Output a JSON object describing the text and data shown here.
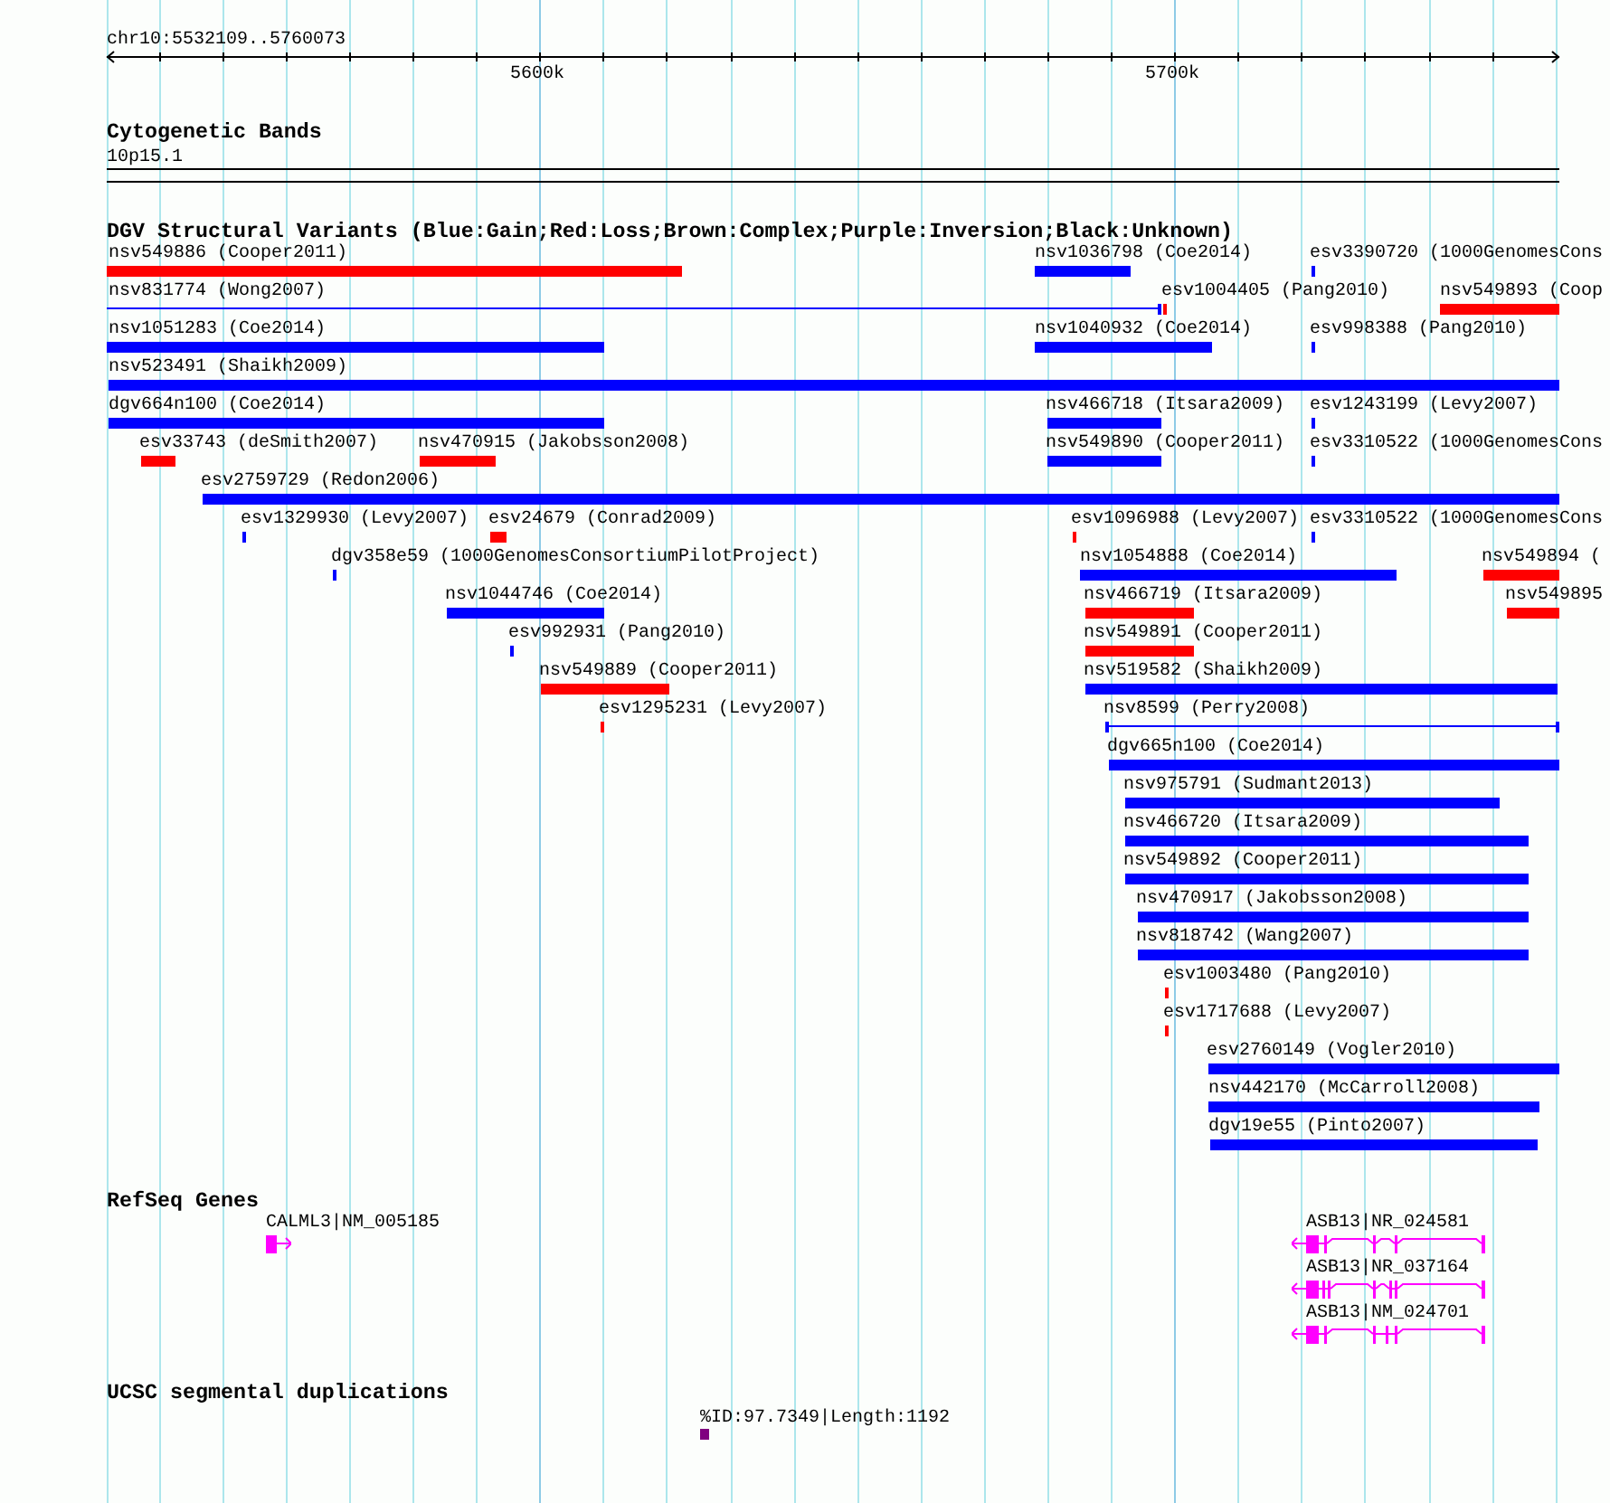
{
  "ruler": {
    "position": "chr10:5532109..5760073",
    "tick_labels": [
      "5600k",
      "5700k"
    ]
  },
  "cytoband_track": {
    "title": "Cytogenetic Bands",
    "band": "10p15.1"
  },
  "dgv_track": {
    "title": "DGV Structural Variants (Blue:Gain;Red:Loss;Brown:Complex;Purple:Inversion;Black:Unknown)",
    "rows": [
      {
        "variants": [
          {
            "label": "nsv549886 (Cooper2011)",
            "kind": "bar",
            "color": "#ff0000"
          },
          {
            "label": "nsv1036798 (Coe2014)",
            "kind": "bar",
            "color": "#0000ff"
          },
          {
            "label": "esv3390720 (1000GenomesCons",
            "kind": "bar",
            "color": "#0000ff"
          }
        ]
      },
      {
        "variants": [
          {
            "label": "nsv831774 (Wong2007)",
            "kind": "line",
            "color": "#0000ff"
          },
          {
            "label": "esv1004405 (Pang2010)",
            "kind": "bar",
            "color": "#ff0000"
          },
          {
            "label": "nsv549893 (Coop",
            "kind": "bar",
            "color": "#ff0000"
          }
        ]
      },
      {
        "variants": [
          {
            "label": "nsv1051283 (Coe2014)",
            "kind": "bar",
            "color": "#0000ff"
          },
          {
            "label": "nsv1040932 (Coe2014)",
            "kind": "bar",
            "color": "#0000ff"
          },
          {
            "label": "esv998388 (Pang2010)",
            "kind": "bar",
            "color": "#0000ff"
          }
        ]
      },
      {
        "variants": [
          {
            "label": "nsv523491 (Shaikh2009)",
            "kind": "bar",
            "color": "#0000ff"
          }
        ]
      },
      {
        "variants": [
          {
            "label": "dgv664n100 (Coe2014)",
            "kind": "bar",
            "color": "#0000ff"
          },
          {
            "label": "nsv466718 (Itsara2009)",
            "kind": "bar",
            "color": "#0000ff"
          },
          {
            "label": "esv1243199 (Levy2007)",
            "kind": "bar",
            "color": "#0000ff"
          }
        ]
      },
      {
        "variants": [
          {
            "label": "esv33743 (deSmith2007)",
            "kind": "bar",
            "color": "#ff0000"
          },
          {
            "label": "nsv470915 (Jakobsson2008)",
            "kind": "bar",
            "color": "#ff0000"
          },
          {
            "label": "nsv549890 (Cooper2011)",
            "kind": "bar",
            "color": "#0000ff"
          },
          {
            "label": "esv3310522 (1000GenomesCons",
            "kind": "bar",
            "color": "#0000ff"
          }
        ]
      },
      {
        "variants": [
          {
            "label": "esv2759729 (Redon2006)",
            "kind": "bar",
            "color": "#0000ff"
          }
        ]
      },
      {
        "variants": [
          {
            "label": "esv1329930 (Levy2007)",
            "kind": "bar",
            "color": "#0000ff"
          },
          {
            "label": "esv24679 (Conrad2009)",
            "kind": "bar",
            "color": "#ff0000"
          },
          {
            "label": "esv1096988 (Levy2007)",
            "kind": "bar",
            "color": "#ff0000"
          },
          {
            "label": "esv3310522 (1000GenomesCons",
            "kind": "bar",
            "color": "#0000ff"
          }
        ]
      },
      {
        "variants": [
          {
            "label": "dgv358e59 (1000GenomesConsortiumPilotProject)",
            "kind": "bar",
            "color": "#0000ff"
          },
          {
            "label": "nsv1054888 (Coe2014)",
            "kind": "bar",
            "color": "#0000ff"
          },
          {
            "label": "nsv549894 (",
            "kind": "bar",
            "color": "#ff0000"
          }
        ]
      },
      {
        "variants": [
          {
            "label": "nsv1044746 (Coe2014)",
            "kind": "bar",
            "color": "#0000ff"
          },
          {
            "label": "nsv466719 (Itsara2009)",
            "kind": "bar",
            "color": "#ff0000"
          },
          {
            "label": "nsv549895",
            "kind": "bar",
            "color": "#ff0000"
          }
        ]
      },
      {
        "variants": [
          {
            "label": "esv992931 (Pang2010)",
            "kind": "bar",
            "color": "#0000ff"
          },
          {
            "label": "nsv549891 (Cooper2011)",
            "kind": "bar",
            "color": "#ff0000"
          }
        ]
      },
      {
        "variants": [
          {
            "label": "nsv549889 (Cooper2011)",
            "kind": "bar",
            "color": "#ff0000"
          },
          {
            "label": "nsv519582 (Shaikh2009)",
            "kind": "bar",
            "color": "#0000ff"
          }
        ]
      },
      {
        "variants": [
          {
            "label": "esv1295231 (Levy2007)",
            "kind": "bar",
            "color": "#ff0000"
          },
          {
            "label": "nsv8599 (Perry2008)",
            "kind": "line",
            "color": "#0000ff"
          }
        ]
      },
      {
        "variants": [
          {
            "label": "dgv665n100 (Coe2014)",
            "kind": "bar",
            "color": "#0000ff"
          }
        ]
      },
      {
        "variants": [
          {
            "label": "nsv975791 (Sudmant2013)",
            "kind": "bar",
            "color": "#0000ff"
          }
        ]
      },
      {
        "variants": [
          {
            "label": "nsv466720 (Itsara2009)",
            "kind": "bar",
            "color": "#0000ff"
          }
        ]
      },
      {
        "variants": [
          {
            "label": "nsv549892 (Cooper2011)",
            "kind": "bar",
            "color": "#0000ff"
          }
        ]
      },
      {
        "variants": [
          {
            "label": "nsv470917 (Jakobsson2008)",
            "kind": "bar",
            "color": "#0000ff"
          }
        ]
      },
      {
        "variants": [
          {
            "label": "nsv818742 (Wang2007)",
            "kind": "bar",
            "color": "#0000ff"
          }
        ]
      },
      {
        "variants": [
          {
            "label": "esv1003480 (Pang2010)",
            "kind": "bar",
            "color": "#ff0000"
          }
        ]
      },
      {
        "variants": [
          {
            "label": "esv1717688 (Levy2007)",
            "kind": "bar",
            "color": "#ff0000"
          }
        ]
      },
      {
        "variants": [
          {
            "label": "esv2760149 (Vogler2010)",
            "kind": "bar",
            "color": "#0000ff"
          }
        ]
      },
      {
        "variants": [
          {
            "label": "nsv442170 (McCarroll2008)",
            "kind": "bar",
            "color": "#0000ff"
          }
        ]
      },
      {
        "variants": [
          {
            "label": "dgv19e55 (Pinto2007)",
            "kind": "bar",
            "color": "#0000ff"
          }
        ]
      }
    ]
  },
  "refseq_track": {
    "title": "RefSeq Genes",
    "rows": [
      {
        "genes": [
          {
            "label": "CALML3|NM_005185",
            "reverse_strand": false
          },
          {
            "label": "ASB13|NR_024581",
            "reverse_strand": true
          }
        ]
      },
      {
        "genes": [
          {
            "label": "ASB13|NR_037164",
            "reverse_strand": true
          }
        ]
      },
      {
        "genes": [
          {
            "label": "ASB13|NM_024701",
            "reverse_strand": true
          }
        ]
      }
    ]
  },
  "segdup_track": {
    "title": "UCSC segmental duplications",
    "features": [
      {
        "label": "%ID:97.7349|Length:1192"
      }
    ]
  }
}
